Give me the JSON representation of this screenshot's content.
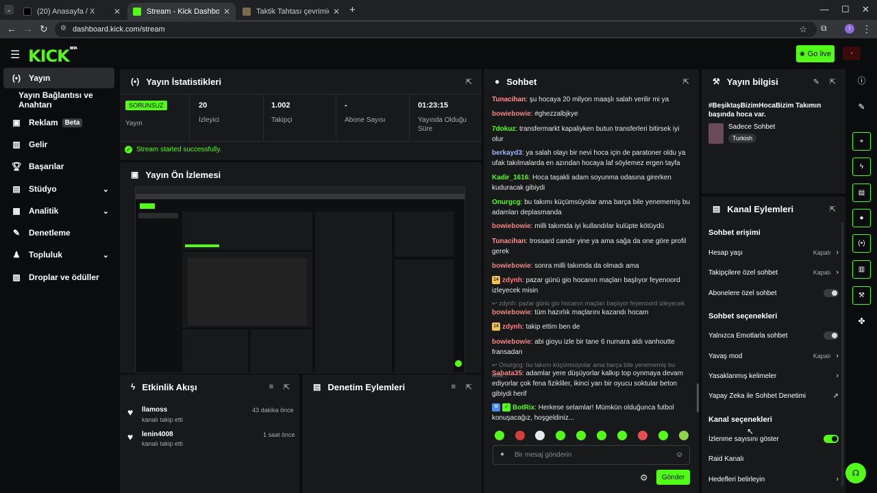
{
  "browser": {
    "tabs": [
      {
        "title": "(20) Anasayfa / X",
        "fav": "#000000"
      },
      {
        "title": "Stream - Kick Dashboard",
        "fav": "#53fc18"
      },
      {
        "title": "Taktik Tahtası çevrimiçi – Futbol",
        "fav": "#7a6b4a"
      }
    ],
    "url": "dashboard.kick.com/stream"
  },
  "header": {
    "logo": "KICK",
    "logo_beta": "BETA",
    "go_live_label": "Go live"
  },
  "sidebar": {
    "items": [
      {
        "label": "Yayın",
        "icon": "stream-icon"
      },
      {
        "label": "Yayın Bağlantısı ve Anahtarı",
        "icon": ""
      },
      {
        "label": "Reklam",
        "icon": "ad-icon",
        "badge": "Beta"
      },
      {
        "label": "Gelir",
        "icon": "revenue-icon"
      },
      {
        "label": "Başarılar",
        "icon": "trophy-icon"
      },
      {
        "label": "Stüdyo",
        "icon": "studio-icon"
      },
      {
        "label": "Analitik",
        "icon": "analytics-icon"
      },
      {
        "label": "Denetleme",
        "icon": "moderation-icon"
      },
      {
        "label": "Topluluk",
        "icon": "community-icon"
      },
      {
        "label": "Droplar ve ödüller",
        "icon": "drops-icon"
      }
    ]
  },
  "stats": {
    "title": "Yayın İstatistikleri",
    "status": "SORUNSUZ",
    "status_label": "Yayın",
    "viewers": "20",
    "viewers_label": "İzleyici",
    "followers": "1.002",
    "followers_label": "Takipçi",
    "subs": "-",
    "subs_label": "Abone Sayısı",
    "duration": "01:23:15",
    "duration_label": "Yayında Olduğu Süre",
    "success": "Stream started successfully."
  },
  "preview": {
    "title": "Yayın Ön İzlemesi"
  },
  "activity": {
    "title": "Etkinlik Akışı",
    "events": [
      {
        "name": "llamoss",
        "sub": "kanalı takip etti",
        "time": "43 dakika önce"
      },
      {
        "name": "lenin4008",
        "sub": "kanalı takip etti",
        "time": "1 saat önce"
      }
    ]
  },
  "mod_actions": {
    "title": "Denetim Eylemleri"
  },
  "chat": {
    "title": "Sohbet",
    "messages": [
      {
        "user": "Tunacihan",
        "color": "#ff8f8f",
        "text": "şu hocaya 20 milyon maaşlı salah verilir mi ya"
      },
      {
        "user": "bowiebowie",
        "color": "#ff7f7f",
        "text": "#ghezzalbjkye"
      },
      {
        "user": "7dokuz",
        "color": "#53fc18",
        "text": "transfermarkt kapaliyken butun transferleri bitirsek iyi olur"
      },
      {
        "user": "berkayd3",
        "color": "#9db6ff",
        "text": "ya salah olayı bir nevi hoca için de paratoner oldu ya ufak takılmalarda en azından hocaya laf söylemez ergen tayfa"
      },
      {
        "user": "Kadir_1616",
        "color": "#53fc18",
        "text": "Hoca taşakli adam soyunma odasına girerken kuduracak gibiydi"
      },
      {
        "user": "Onurgcg",
        "color": "#53fc18",
        "text": "bu takımı küçümsüyolar ama barça bile yenememiş bu adamları deplasmanda"
      },
      {
        "user": "bowiebowie",
        "color": "#ff7f7f",
        "text": "milli takımda iyi kullandılar kulüpte kötüydü"
      },
      {
        "user": "Tunacihan",
        "color": "#ff8f8f",
        "text": "trossard candır yine ya ama sağa da one göre profil gerek"
      },
      {
        "user": "bowiebowie",
        "color": "#ff7f7f",
        "text": "sonra milli takımda da olmadı ama"
      },
      {
        "user": "zdynh",
        "color": "#ff7f7f",
        "badge": "14",
        "text": "pazar günü gio hocanın maçları başlıyor feyenoord izleyecek misin"
      },
      {
        "reply": "zdynh: pazar günü gio hocanın maçları başlıyor feyenoord izleyecek ..."
      },
      {
        "user": "bowiebowie",
        "color": "#ff7f7f",
        "text": "tüm hazırlık maçlarını kazandı hocam"
      },
      {
        "user": "zdynh",
        "color": "#ff7f7f",
        "badge": "14",
        "text": "takip ettim ben de"
      },
      {
        "user": "bowiebowie",
        "color": "#ff7f7f",
        "text": "abi gioyu izle bir tane 6 numara aldı vanhoutte fransadan"
      },
      {
        "reply": "Onurgcg: bu takımı küçümsüyolar ama barça bile yenememiş bu ada..."
      },
      {
        "user": "Sabata35",
        "color": "#ff7f7f",
        "text": "adamlar yere düşüyorlar kalkıp top oynmaya devam ediyorlar çok fena fizikliler, ikinci yarı bir oyucu soktular beton gibiydi herif"
      },
      {
        "user": "BotRix",
        "color": "#53fc18",
        "text": "Herkese selamlar! Mümkün olduğunca futbol konuşacağız, hoşgeldiniz..."
      }
    ],
    "input_placeholder": "Bir mesaj gönderin",
    "send_label": "Gönder"
  },
  "stream_info": {
    "title": "Yayın bilgisi",
    "stream_title": "#BeşiktaşBizimHocaBizim Takımın başında hoca var.",
    "category": "Sadece Sohbet",
    "tag": "Turkish"
  },
  "channel_actions": {
    "title": "Kanal Eylemleri",
    "sections": [
      {
        "heading": "Sohbet erişimi",
        "rows": [
          {
            "label": "Hesap yaşı",
            "value": "Kapalı",
            "type": "chevron"
          },
          {
            "label": "Takipçilere özel sohbet",
            "value": "Kapalı",
            "type": "chevron"
          },
          {
            "label": "Abonelere özel sohbet",
            "value": "",
            "type": "toggle",
            "on": false
          }
        ]
      },
      {
        "heading": "Sohbet seçenekleri",
        "rows": [
          {
            "label": "Yalnızca Emotlarla sohbet",
            "value": "",
            "type": "toggle",
            "on": false
          },
          {
            "label": "Yavaş mod",
            "value": "Kapalı",
            "type": "chevron"
          },
          {
            "label": "Yasaklanmış kelimeler",
            "value": "",
            "type": "chevron"
          },
          {
            "label": "Yapay Zeka ile Sohbet Denetimi",
            "value": "",
            "type": "external"
          }
        ]
      },
      {
        "heading": "Kanal seçenekleri",
        "rows": [
          {
            "label": "İzlenme sayısını göster",
            "value": "",
            "type": "toggle",
            "on": true
          },
          {
            "label": "Raid Kanalı",
            "value": "",
            "type": "none"
          },
          {
            "label": "Hedefleri belirleyin",
            "value": "",
            "type": "chevron"
          }
        ]
      }
    ]
  },
  "colors": {
    "accent": "#53fc18",
    "panel": "#18191b",
    "bg": "#0b0c0d"
  }
}
